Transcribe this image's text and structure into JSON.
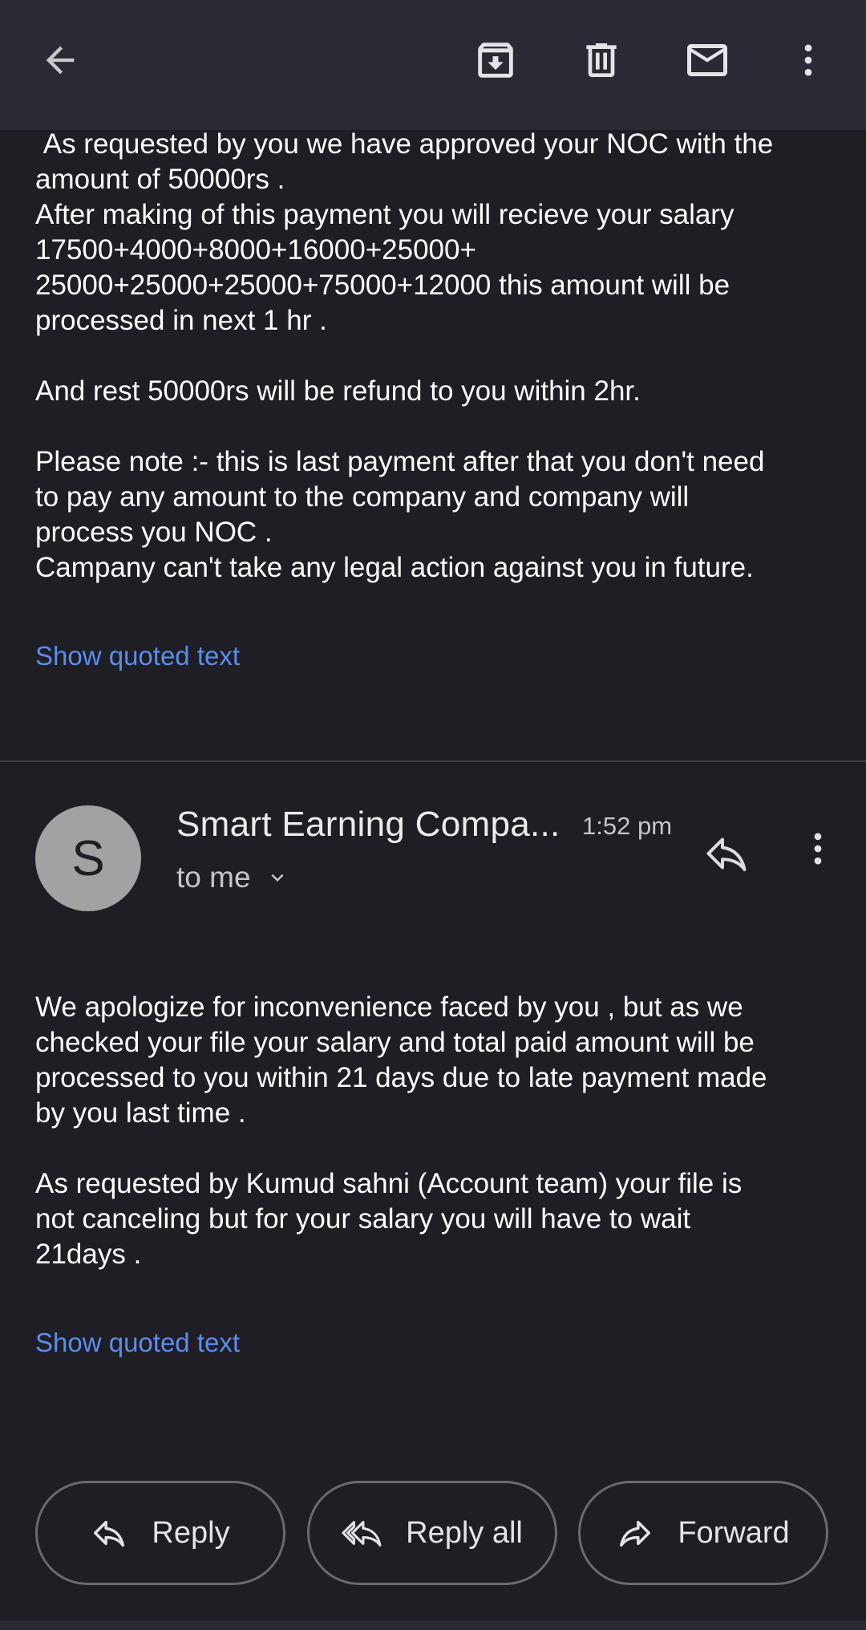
{
  "toolbar": {
    "icons": [
      "back-arrow-icon",
      "archive-icon",
      "delete-icon",
      "mark-unread-icon",
      "more-vert-icon"
    ]
  },
  "message1": {
    "paragraphs": [
      " As requested by you we have approved your NOC with the\namount of 50000rs .\nAfter making of this payment you will recieve your salary\n17500+4000+8000+16000+25000+\n25000+25000+25000+75000+12000 this amount will be\nprocessed in next 1 hr .",
      "And rest 50000rs will be refund to you within 2hr.",
      "Please note :- this is last payment after that you don't need\nto pay any amount to the company and company will\nprocess you NOC .\nCampany can't take any legal action against you in future."
    ],
    "show_quoted": "Show quoted text"
  },
  "message2": {
    "avatar_letter": "S",
    "sender": "Smart Earning Compa...",
    "time": "1:52 pm",
    "recipient": "to me",
    "paragraphs": [
      "We apologize for inconvenience faced by you , but as we\nchecked your file your salary and total paid amount will be\nprocessed to you within 21 days due to late payment made\nby you last time .",
      "As requested by Kumud sahni (Account team) your file is\nnot canceling but for your salary you will have to wait\n21days ."
    ],
    "show_quoted": "Show quoted text"
  },
  "actions": {
    "reply": "Reply",
    "reply_all": "Reply all",
    "forward": "Forward"
  },
  "colors": {
    "background": "#1f1e24",
    "toolbar": "#2a2a34",
    "link": "#5b8df0",
    "avatar": "#a2a2a2"
  }
}
